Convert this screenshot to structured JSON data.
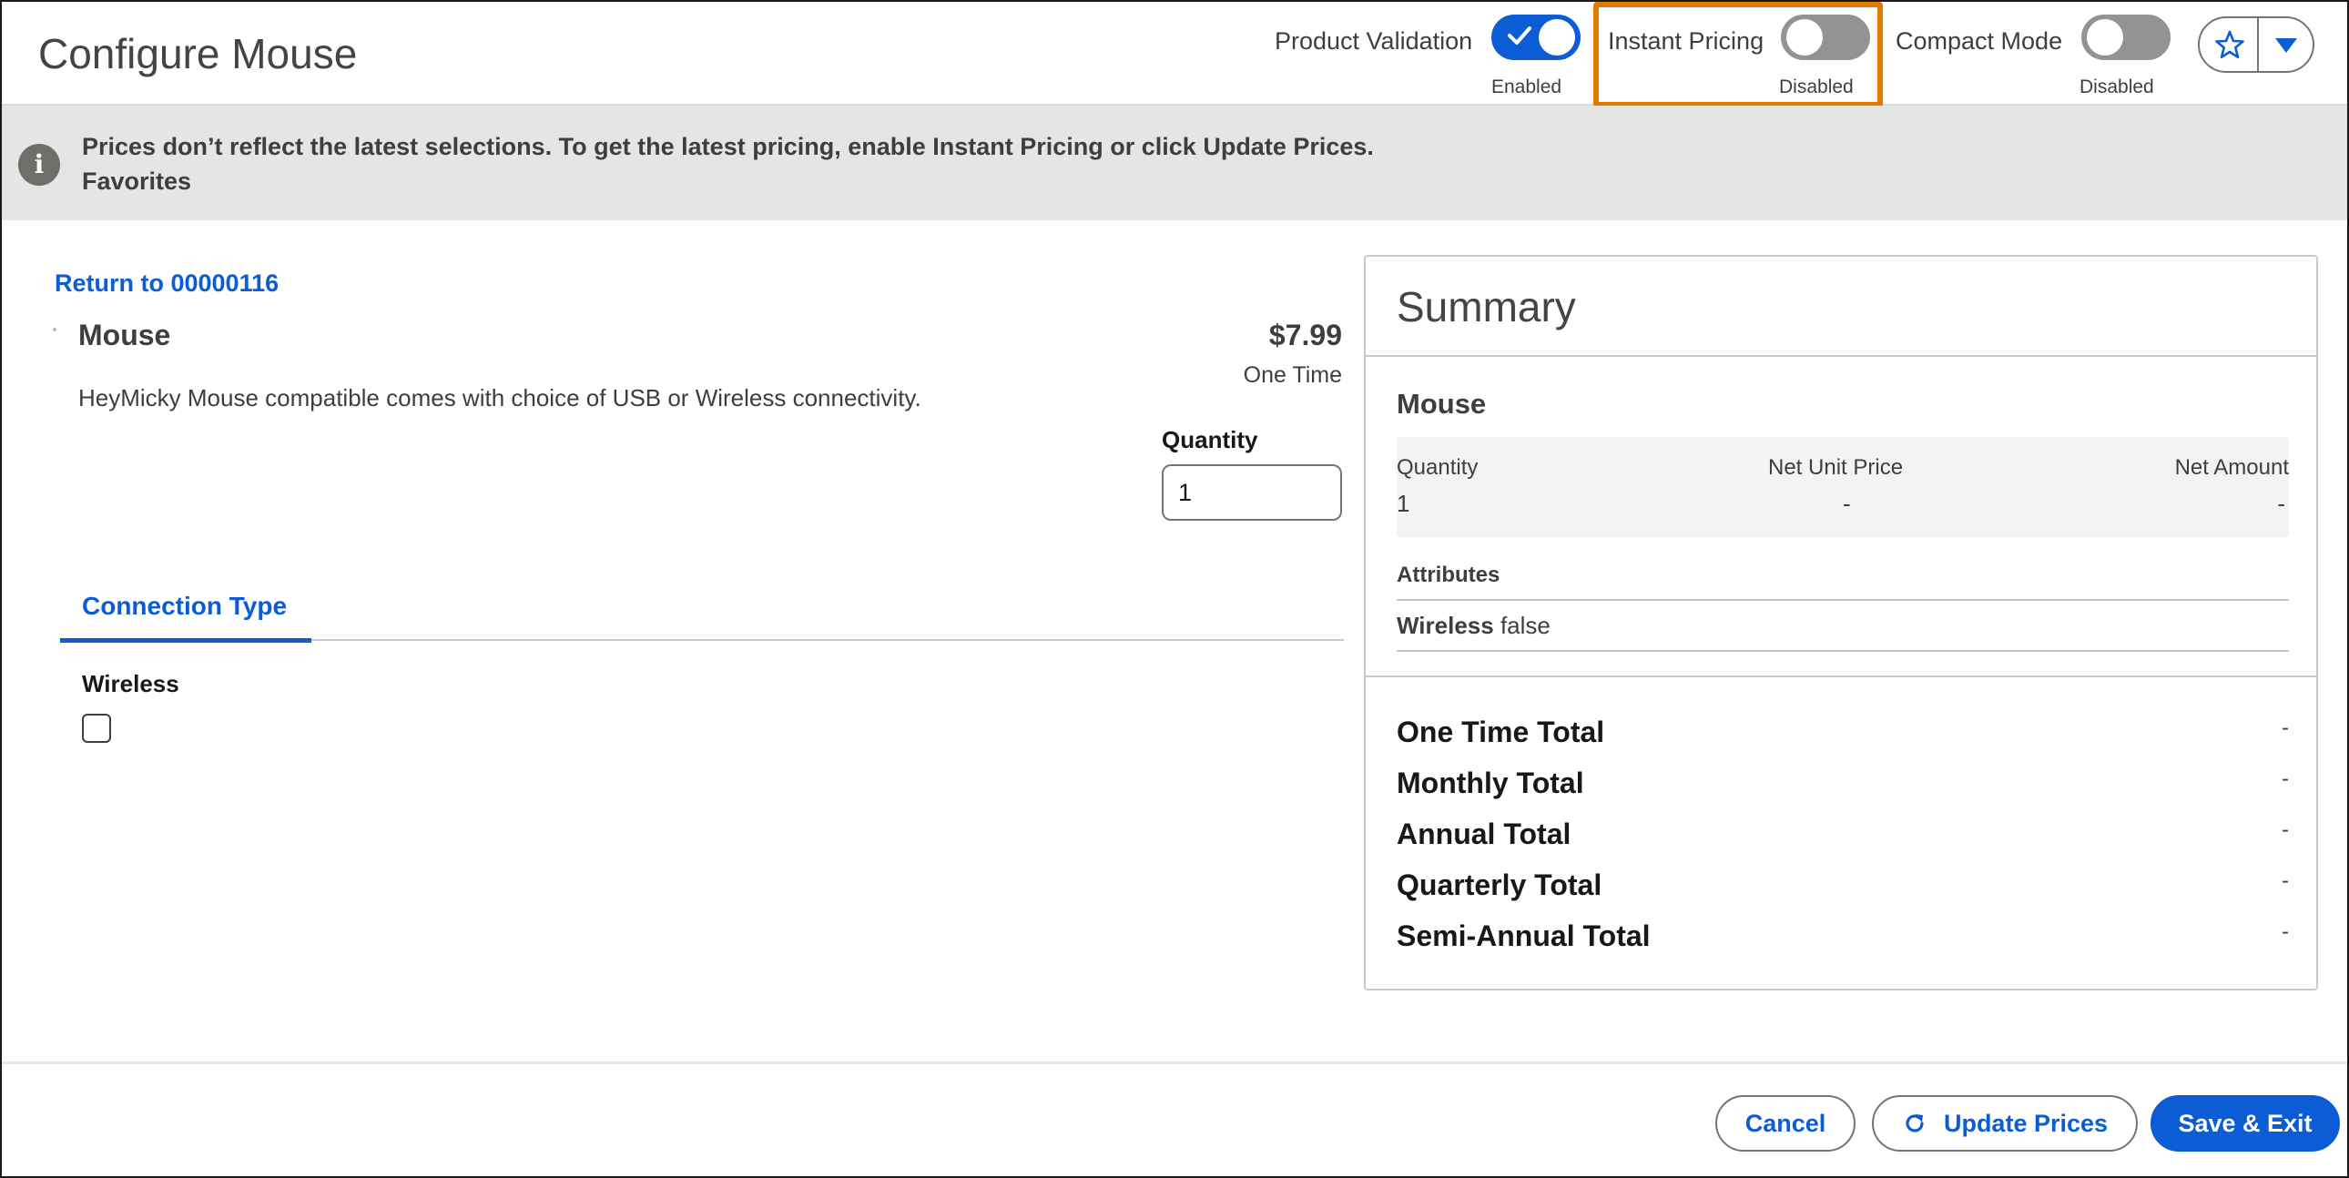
{
  "header": {
    "title": "Configure Mouse",
    "toggles": [
      {
        "label": "Product Validation",
        "state": "Enabled"
      },
      {
        "label": "Instant Pricing",
        "state": "Disabled"
      },
      {
        "label": "Compact Mode",
        "state": "Disabled"
      }
    ]
  },
  "notice": {
    "message": "Prices don’t reflect the latest selections. To get the latest pricing, enable Instant Pricing or click Update Prices.",
    "sub": "Favorites"
  },
  "product": {
    "return_link": "Return to 00000116",
    "name": "Mouse",
    "price": "$7.99",
    "frequency": "One Time",
    "description": "HeyMicky Mouse compatible comes with choice of USB or Wireless connectivity.",
    "quantity_label": "Quantity",
    "quantity_value": "1",
    "tab_label": "Connection Type",
    "attribute_label": "Wireless"
  },
  "summary": {
    "title": "Summary",
    "product": "Mouse",
    "headers": [
      "Quantity",
      "Net Unit Price",
      "Net Amount"
    ],
    "values": [
      "1",
      "-",
      "-"
    ],
    "attributes_title": "Attributes",
    "attribute_name": "Wireless",
    "attribute_value": "false",
    "totals": [
      {
        "label": "One Time Total",
        "value": "-"
      },
      {
        "label": "Monthly Total",
        "value": "-"
      },
      {
        "label": "Annual Total",
        "value": "-"
      },
      {
        "label": "Quarterly Total",
        "value": "-"
      },
      {
        "label": "Semi-Annual Total",
        "value": "-"
      }
    ]
  },
  "footer": {
    "cancel": "Cancel",
    "update": "Update Prices",
    "save": "Save & Exit"
  },
  "colors": {
    "brand": "#0b5cd5",
    "highlight": "#e07b00",
    "notice_bg": "#e5e5e5"
  }
}
